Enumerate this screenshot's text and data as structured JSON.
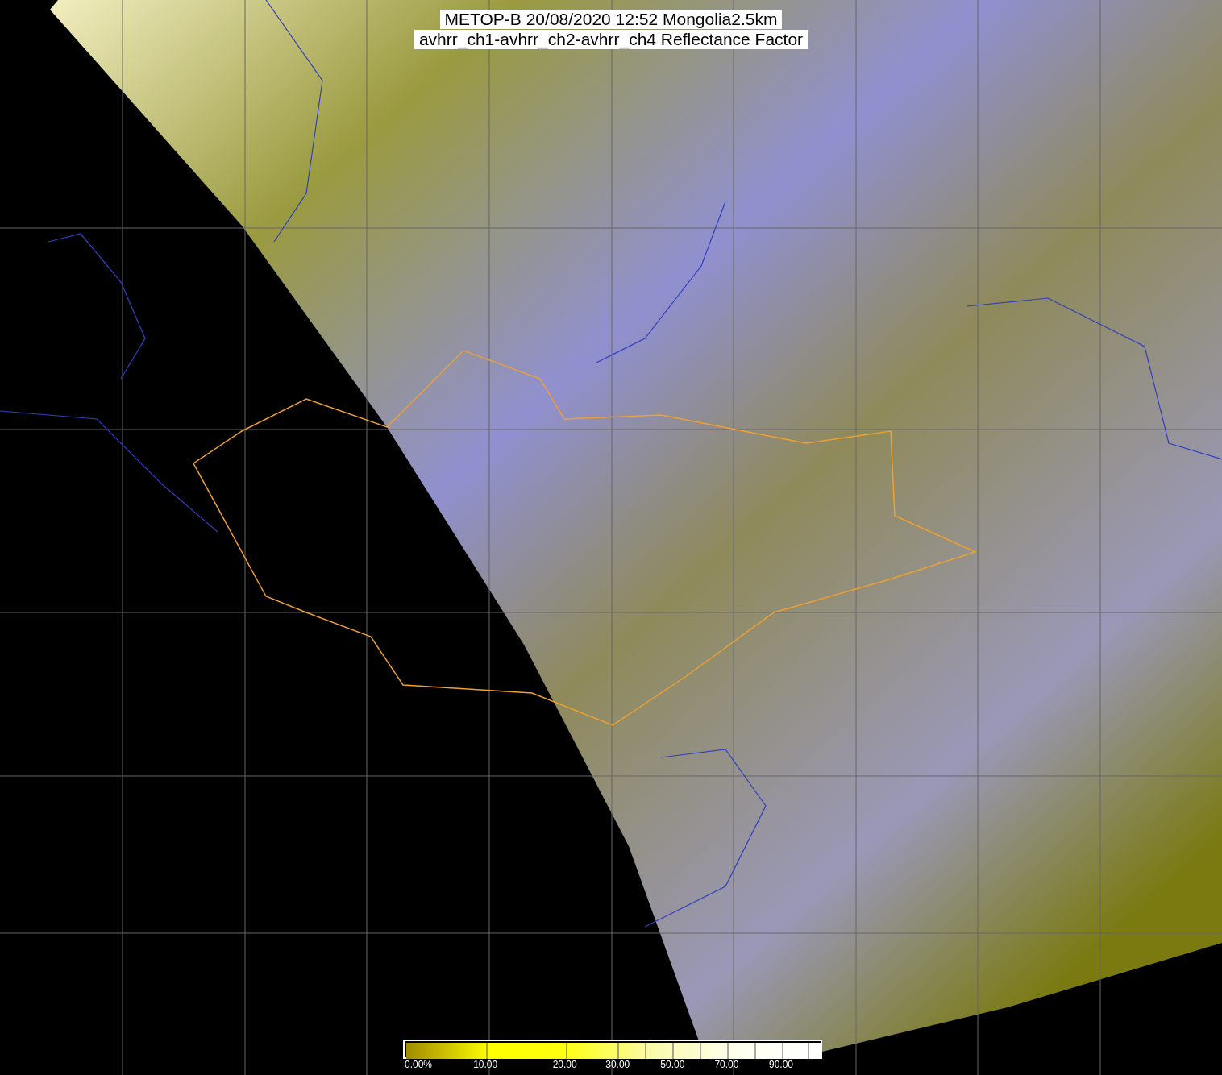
{
  "title": {
    "lines": [
      "METOP-B 20/08/2020 12:52 Mongolia2.5km",
      "avhrr_ch1-avhrr_ch2-avhrr_ch4 Reflectance Factor"
    ]
  },
  "colorbar": {
    "labels": [
      "0.00%",
      "10.00",
      "20.00",
      "30.00",
      "50.00",
      "70.00",
      "90.00"
    ]
  }
}
